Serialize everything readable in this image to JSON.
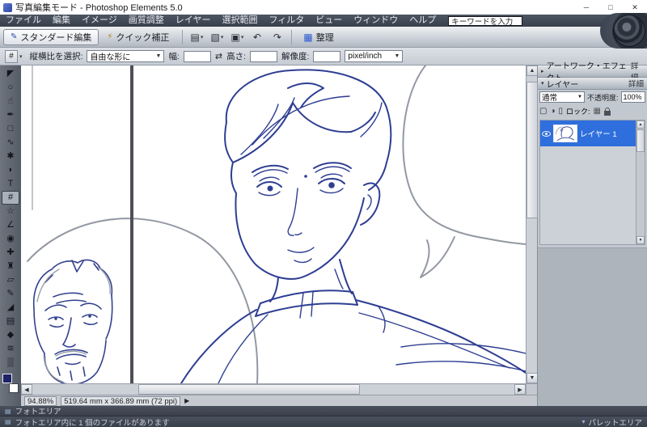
{
  "window": {
    "title": "写真編集モード - Photoshop Elements 5.0",
    "minimize": "─",
    "maximize": "□",
    "close": "✕"
  },
  "icons": {
    "caret_down": "▾",
    "dropdown_arrow": "▼",
    "swap": "⇄",
    "scroll_up": "▲",
    "scroll_down": "▼",
    "scroll_left": "◀",
    "scroll_right": "▶",
    "status_arrow": "▶",
    "header_collapsed": "▸",
    "header_expanded": "▾",
    "standard_edit_glyph": "✎",
    "quick_fix_glyph": "⚡",
    "organize_glyph": "▦",
    "tool_preset_glyph": "#",
    "new_layer_glyph": "▢",
    "adjustment_layer_glyph": "◑",
    "delete_layer_glyph": "▯",
    "lock_transparent_glyph": "▦",
    "photo_bin_glyph": "▤",
    "palette_area_glyph": "▾"
  },
  "menubar": {
    "items": [
      {
        "name": "menu-file",
        "label": "ファイル"
      },
      {
        "name": "menu-edit",
        "label": "編集"
      },
      {
        "name": "menu-image",
        "label": "イメージ"
      },
      {
        "name": "menu-enhance",
        "label": "画質調整"
      },
      {
        "name": "menu-layer",
        "label": "レイヤー"
      },
      {
        "name": "menu-select",
        "label": "選択範囲"
      },
      {
        "name": "menu-filter",
        "label": "フィルタ"
      },
      {
        "name": "menu-view",
        "label": "ビュー"
      },
      {
        "name": "menu-window",
        "label": "ウィンドウ"
      },
      {
        "name": "menu-help",
        "label": "ヘルプ"
      }
    ],
    "search_value": "キーワードを入力"
  },
  "shortcut_bar": {
    "tabs": [
      {
        "name": "tab-standard-edit",
        "label": "スタンダード編集",
        "active": true
      },
      {
        "name": "tab-quick-fix",
        "label": "クイック補正"
      }
    ],
    "buttons": [
      {
        "name": "new-file-button",
        "glyph": "▤",
        "caret": "▾"
      },
      {
        "name": "open-button",
        "glyph": "▧",
        "caret": "▾"
      },
      {
        "name": "print-button",
        "glyph": "▣",
        "caret": "▾"
      },
      {
        "name": "undo-button",
        "glyph": "↶",
        "caret": ""
      },
      {
        "name": "redo-button",
        "glyph": "↷",
        "caret": ""
      }
    ],
    "organize_label": "整理"
  },
  "options_bar": {
    "aspect_label": "縦横比を選択:",
    "aspect_value": "自由な形に",
    "width_label": "幅:",
    "width_value": "",
    "height_label": "高さ:",
    "height_value": "",
    "resolution_label": "解像度:",
    "resolution_value": "",
    "unit_value": "pixel/inch"
  },
  "tools": [
    {
      "name": "move-tool",
      "glyph": "◤"
    },
    {
      "name": "zoom-tool",
      "glyph": "○"
    },
    {
      "name": "hand-tool",
      "glyph": "☝"
    },
    {
      "name": "eyedropper-tool",
      "glyph": "✒"
    },
    {
      "name": "marquee-tool",
      "glyph": "□"
    },
    {
      "name": "lasso-tool",
      "glyph": "∿"
    },
    {
      "name": "magic-wand-tool",
      "glyph": "✱"
    },
    {
      "name": "selection-brush-tool",
      "glyph": "◗"
    },
    {
      "name": "type-tool",
      "glyph": "T"
    },
    {
      "name": "crop-tool",
      "glyph": "#",
      "active": true
    },
    {
      "name": "cookie-cutter-tool",
      "glyph": "☆"
    },
    {
      "name": "straighten-tool",
      "glyph": "∠"
    },
    {
      "name": "red-eye-tool",
      "glyph": "◉"
    },
    {
      "name": "healing-brush-tool",
      "glyph": "✚"
    },
    {
      "name": "clone-stamp-tool",
      "glyph": "♜"
    },
    {
      "name": "eraser-tool",
      "glyph": "▱"
    },
    {
      "name": "brush-tool",
      "glyph": "✎"
    },
    {
      "name": "paint-bucket-tool",
      "glyph": "◢"
    },
    {
      "name": "gradient-tool",
      "glyph": "▤"
    },
    {
      "name": "shape-tool",
      "glyph": "◆"
    },
    {
      "name": "blur-tool",
      "glyph": "≋"
    },
    {
      "name": "sponge-tool",
      "glyph": "▒"
    }
  ],
  "status_bar": {
    "zoom": "94.88%",
    "doc_size": "519.64 mm x 366.89 mm (72 ppi)"
  },
  "palettes": {
    "artwork_header": "アートワーク・エフェクト",
    "artwork_details": "詳細",
    "layers_header": "レイヤー",
    "layers_details": "詳細",
    "blend_mode": "通常",
    "opacity_label": "不透明度:",
    "opacity_value": "100%",
    "lock_label": "ロック:",
    "layer1_name": "レイヤー 1",
    "palette_area_label": "パレットエリア"
  },
  "photo_bin": {
    "label": "フォトエリア",
    "status": "フォトエリア内に 1 個のファイルがあります"
  }
}
